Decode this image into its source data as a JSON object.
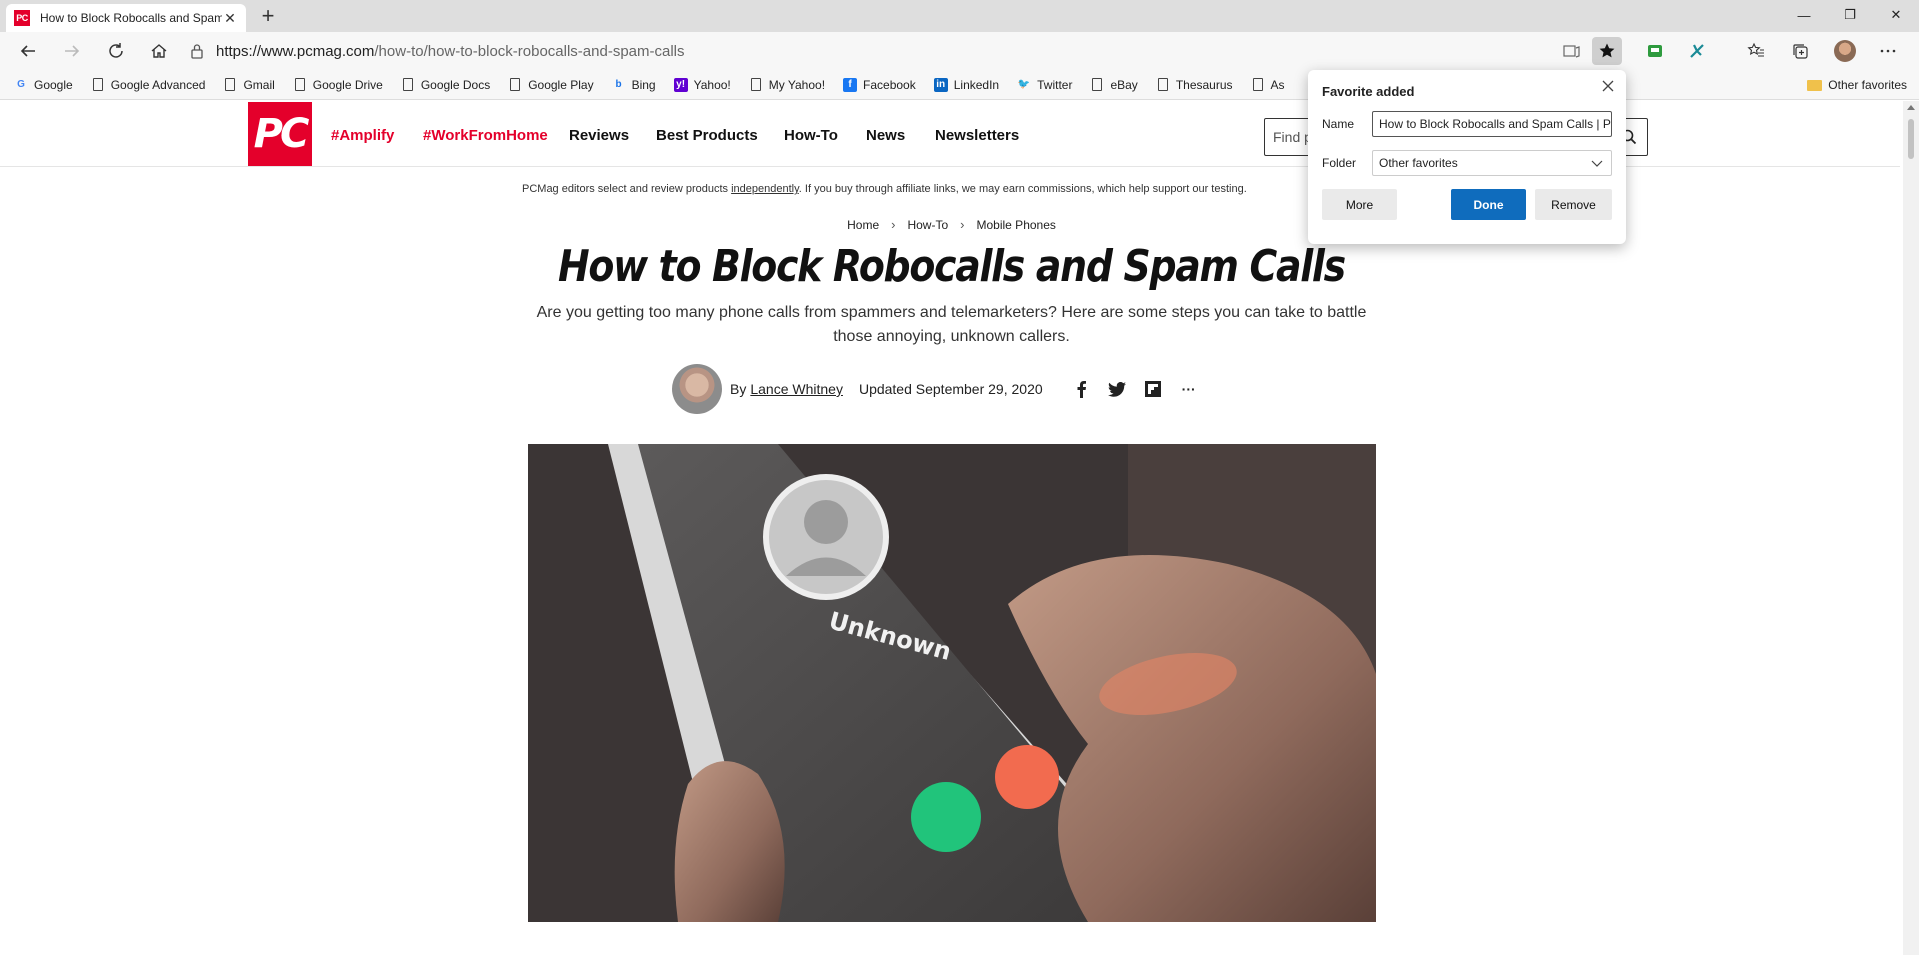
{
  "browser": {
    "tab_title": "How to Block Robocalls and Spam Calls | PCMag",
    "tab_favicon": "PC",
    "new_tab": "+",
    "window": {
      "minimize": "—",
      "restore": "❐",
      "close": "✕"
    },
    "address": {
      "domain": "https://www.pcmag.com",
      "path": "/how-to/how-to-block-robocalls-and-spam-calls"
    },
    "bookmarks": [
      {
        "label": "Google",
        "icon": "google-g-icon"
      },
      {
        "label": "Google Advanced",
        "icon": "page-icon"
      },
      {
        "label": "Gmail",
        "icon": "page-icon"
      },
      {
        "label": "Google Drive",
        "icon": "page-icon"
      },
      {
        "label": "Google Docs",
        "icon": "page-icon"
      },
      {
        "label": "Google Play",
        "icon": "page-icon"
      },
      {
        "label": "Bing",
        "icon": "bing-icon"
      },
      {
        "label": "Yahoo!",
        "icon": "yahoo-icon"
      },
      {
        "label": "My Yahoo!",
        "icon": "page-icon"
      },
      {
        "label": "Facebook",
        "icon": "facebook-icon"
      },
      {
        "label": "LinkedIn",
        "icon": "linkedin-icon"
      },
      {
        "label": "Twitter",
        "icon": "twitter-icon"
      },
      {
        "label": "eBay",
        "icon": "page-icon"
      },
      {
        "label": "Thesaurus",
        "icon": "page-icon"
      },
      {
        "label": "As",
        "icon": "page-icon"
      }
    ],
    "other_favorites": "Other favorites"
  },
  "site": {
    "logo": "PC",
    "nav": [
      "#Amplify",
      "#WorkFromHome",
      "Reviews",
      "Best Products",
      "How-To",
      "News",
      "Newsletters"
    ],
    "search_placeholder": "Find p"
  },
  "article": {
    "disclaimer_pre": "PCMag editors select and review products ",
    "disclaimer_link": "independently",
    "disclaimer_post": ". If you buy through affiliate links, we may earn commissions, which help support our testing.",
    "breadcrumbs": [
      "Home",
      "How-To",
      "Mobile Phones"
    ],
    "breadcrumb_sep": "›",
    "title": "How to Block Robocalls and Spam Calls",
    "dek": "Are you getting too many phone calls from spammers and telemarketers? Here are some steps you can take to battle those annoying, unknown callers.",
    "by": "By",
    "author": "Lance Whitney",
    "updated": "Updated September 29, 2020",
    "share_more": "···",
    "hero_caller": "Unknown"
  },
  "favorite_popup": {
    "title": "Favorite added",
    "name_label": "Name",
    "name_value": "How to Block Robocalls and Spam Calls | PCMag",
    "folder_label": "Folder",
    "folder_value": "Other favorites",
    "more": "More",
    "done": "Done",
    "remove": "Remove"
  },
  "colors": {
    "pcmag_red": "#e4002b",
    "edge_blue": "#0f6cbd"
  }
}
